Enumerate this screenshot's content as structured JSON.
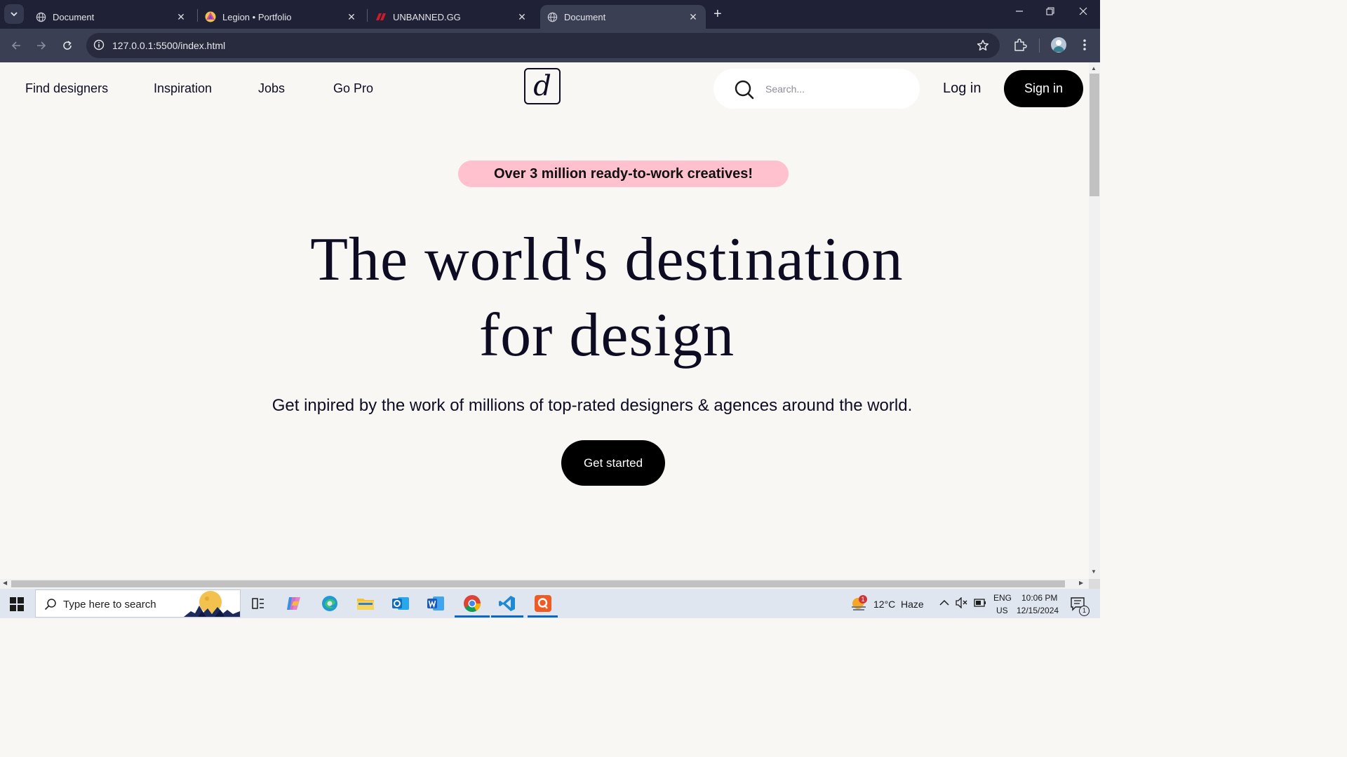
{
  "browser": {
    "tabs": [
      {
        "title": "Document",
        "active": false
      },
      {
        "title": "Legion • Portfolio",
        "active": false
      },
      {
        "title": "UNBANNED.GG",
        "active": false
      },
      {
        "title": "Document",
        "active": true
      }
    ],
    "url": "127.0.0.1:5500/index.html"
  },
  "site": {
    "nav": [
      "Find designers",
      "Inspiration",
      "Jobs",
      "Go Pro"
    ],
    "logo_letter": "d",
    "search_placeholder": "Search...",
    "login_label": "Log in",
    "signin_label": "Sign in",
    "badge": "Over 3 million ready-to-work creatives!",
    "headline_line1": "The world's destination",
    "headline_line2": "for design",
    "subtitle": "Get inpired by the work of millions of top-rated designers & agences around the world.",
    "cta_label": "Get started"
  },
  "taskbar": {
    "search_placeholder": "Type here to search",
    "weather_temp": "12°C",
    "weather_desc": "Haze",
    "weather_badge": "1",
    "lang_top": "ENG",
    "lang_bottom": "US",
    "time": "10:06 PM",
    "date": "12/15/2024",
    "notification_count": "1"
  },
  "colors": {
    "page_bg": "#f8f7f4",
    "badge_bg": "#fec1cd",
    "button_bg": "#000000",
    "titlebar_bg": "#1f2236",
    "toolbar_bg": "#3b3f53"
  }
}
